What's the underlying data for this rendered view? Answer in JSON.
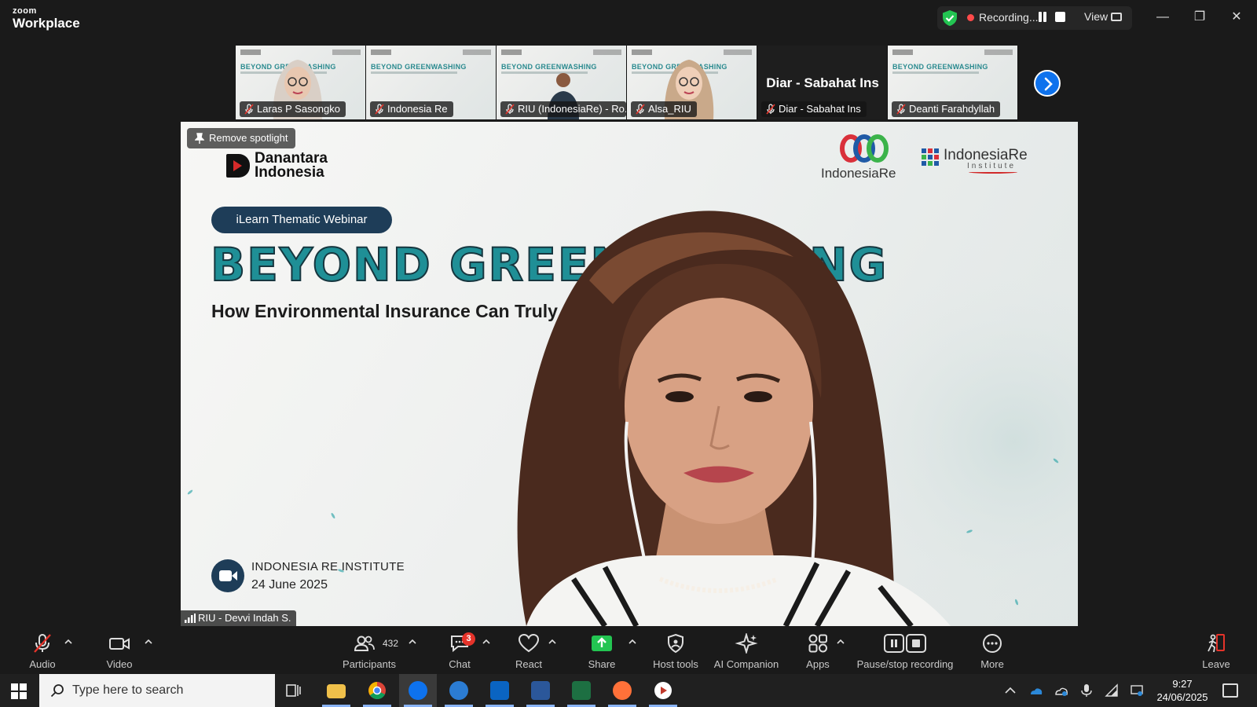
{
  "app": {
    "logo_small": "zoom",
    "logo_big": "Workplace"
  },
  "recording": {
    "status": "Recording...",
    "view_label": "View"
  },
  "window_controls": {
    "minimize": "—",
    "restore": "❐",
    "close": "✕"
  },
  "thumbnails": [
    {
      "name": "Laras P Sasongko",
      "kind": "person",
      "skin": "#e8c7b0",
      "hijab": "#d9cfc6"
    },
    {
      "name": "Indonesia Re",
      "kind": "slide"
    },
    {
      "name": "RIU (IndonesiaRe) - Ro...",
      "kind": "person-small"
    },
    {
      "name": "Alsa_RIU",
      "kind": "person",
      "skin": "#efcfb8",
      "hijab": "#c9a98a"
    },
    {
      "name": "Diar - Sabahat Ins",
      "kind": "dark",
      "display": "Diar - Sabahat Ins"
    },
    {
      "name": "Deanti Farahdyllah",
      "kind": "slide"
    }
  ],
  "thumb_slide_title": "BEYOND GREENWASHING",
  "spotlight": {
    "remove_label": "Remove spotlight",
    "logo_left": "Danantara\nIndonesia",
    "logo_ire": "IndonesiaRe",
    "logo_iri": "IndonesiaRe",
    "logo_iri_sub": "Institute",
    "pill": "iLearn Thematic Webinar",
    "title": "BEYOND GREENWASHING",
    "subtitle": "How Environmental Insurance Can Truly Drive Sustainability",
    "org": "INDONESIA RE INSTITUTE",
    "date": "24 June 2025",
    "speaker_name": "RIU - Devvi Indah S."
  },
  "toolbar": {
    "audio": "Audio",
    "video": "Video",
    "participants": "Participants",
    "participants_count": "432",
    "chat": "Chat",
    "chat_badge": "3",
    "react": "React",
    "share": "Share",
    "host_tools": "Host tools",
    "ai_companion": "AI Companion",
    "apps": "Apps",
    "pause_recording": "Pause/stop recording",
    "more": "More",
    "leave": "Leave"
  },
  "taskbar": {
    "search_placeholder": "Type here to search",
    "time": "9:27",
    "date": "24/06/2025"
  },
  "colors": {
    "accent_blue": "#0e72ed",
    "share_green": "#23c552",
    "record_red": "#ff4a4a",
    "title_teal": "#1f8f96",
    "navy": "#1e3d58"
  }
}
